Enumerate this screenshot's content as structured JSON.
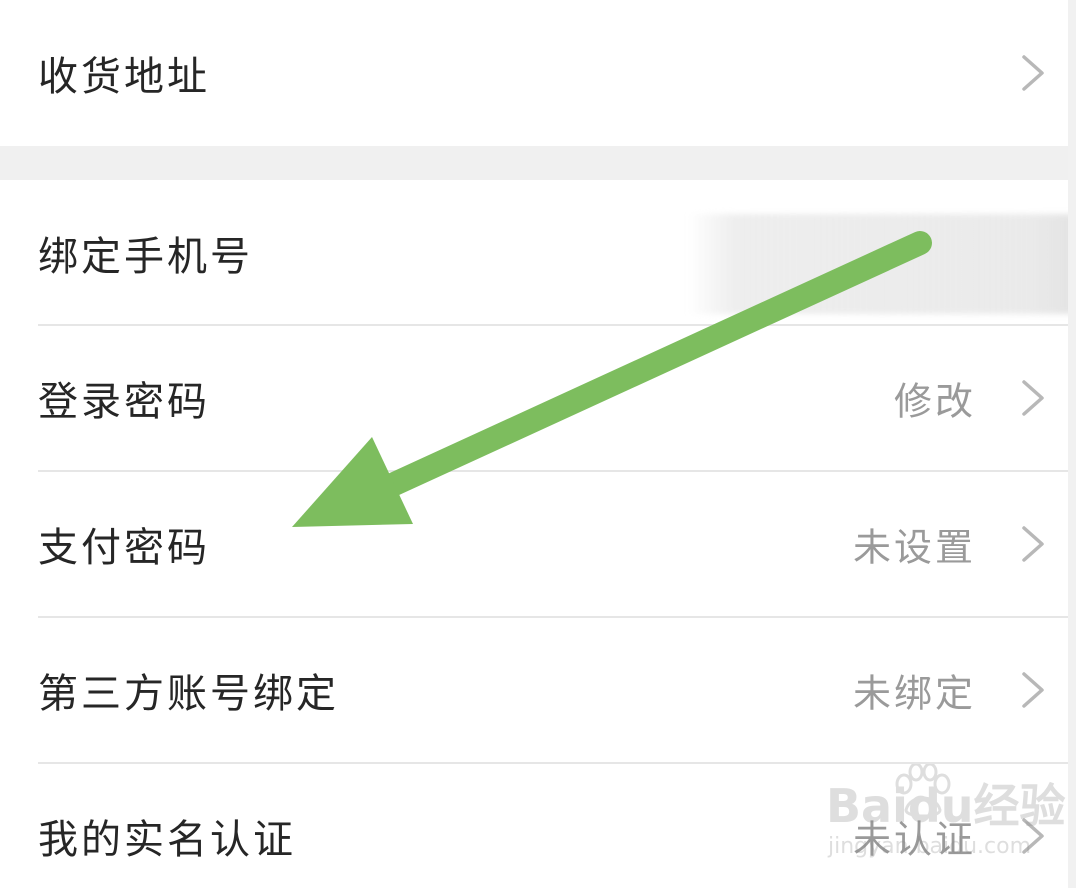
{
  "settings": {
    "items": [
      {
        "label": "收货地址",
        "value": ""
      },
      {
        "label": "绑定手机号",
        "value": ""
      },
      {
        "label": "登录密码",
        "value": "修改"
      },
      {
        "label": "支付密码",
        "value": "未设置"
      },
      {
        "label": "第三方账号绑定",
        "value": "未绑定"
      },
      {
        "label": "我的实名认证",
        "value": "未认证"
      }
    ]
  },
  "annotation": {
    "arrow_color": "#7dbd5e",
    "arrow_icon": "green-arrow-pointer"
  },
  "watermark": {
    "text": "Baidu经验",
    "subtext": "jingyan.baidu.com",
    "icon": "paw-icon"
  },
  "colors": {
    "label": "#262626",
    "value": "#9a9a9a",
    "chevron": "#b8b8b8",
    "divider": "#e6e6e6",
    "section_bg": "#f0f0f0"
  }
}
